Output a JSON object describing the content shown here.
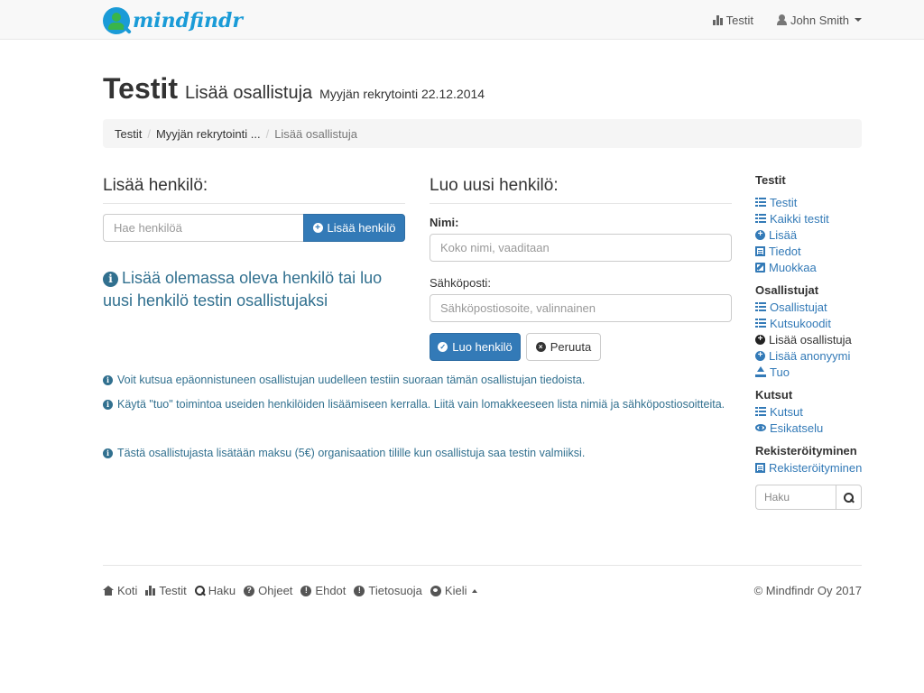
{
  "brand": {
    "name": "mindfindr"
  },
  "nav": {
    "tests_label": "Testit",
    "user_name": "John Smith"
  },
  "header": {
    "title": "Testit",
    "subtitle": "Lisää osallistuja",
    "context": "Myyjän rekrytointi 22.12.2014"
  },
  "breadcrumb": {
    "items": [
      "Testit",
      "Myyjän rekrytointi ...",
      "Lisää osallistuja"
    ]
  },
  "left": {
    "heading": "Lisää henkilö:",
    "search_placeholder": "Hae henkilöä",
    "add_button": "Lisää henkilö",
    "info_text": "Lisää olemassa oleva henkilö tai luo uusi henkilö testin osallistujaksi"
  },
  "right": {
    "heading": "Luo uusi henkilö:",
    "name_label": "Nimi:",
    "name_placeholder": "Koko nimi, vaaditaan",
    "email_label": "Sähköposti:",
    "email_placeholder": "Sähköpostiosoite, valinnainen",
    "create_button": "Luo henkilö",
    "cancel_button": "Peruuta"
  },
  "notes": [
    "Voit kutsua epäonnistuneen osallistujan uudelleen testiin suoraan tämän osallistujan tiedoista.",
    "Käytä \"tuo\" toimintoa useiden henkilöiden lisäämiseen kerralla. Liitä vain lomakkeeseen lista nimiä ja sähköpostiosoitteita.",
    "Tästä osallistujasta lisätään maksu (5€) organisaation tilille kun osallistuja saa testin valmiiksi."
  ],
  "sidebar": {
    "sections": [
      {
        "heading": "Testit",
        "items": [
          "Testit",
          "Kaikki testit",
          "Lisää",
          "Tiedot",
          "Muokkaa"
        ]
      },
      {
        "heading": "Osallistujat",
        "items": [
          "Osallistujat",
          "Kutsukoodit",
          "Lisää osallistuja",
          "Lisää anonyymi",
          "Tuo"
        ]
      },
      {
        "heading": "Kutsut",
        "items": [
          "Kutsut",
          "Esikatselu"
        ]
      },
      {
        "heading": "Rekisteröityminen",
        "items": [
          "Rekisteröityminen"
        ]
      }
    ],
    "search_placeholder": "Haku"
  },
  "footer": {
    "links": [
      "Koti",
      "Testit",
      "Haku",
      "Ohjeet",
      "Ehdot",
      "Tietosuoja",
      "Kieli"
    ],
    "copyright": "© Mindfindr Oy 2017"
  },
  "colors": {
    "primary": "#337ab7",
    "info": "#31708f",
    "brand": "#1a9bd7"
  }
}
